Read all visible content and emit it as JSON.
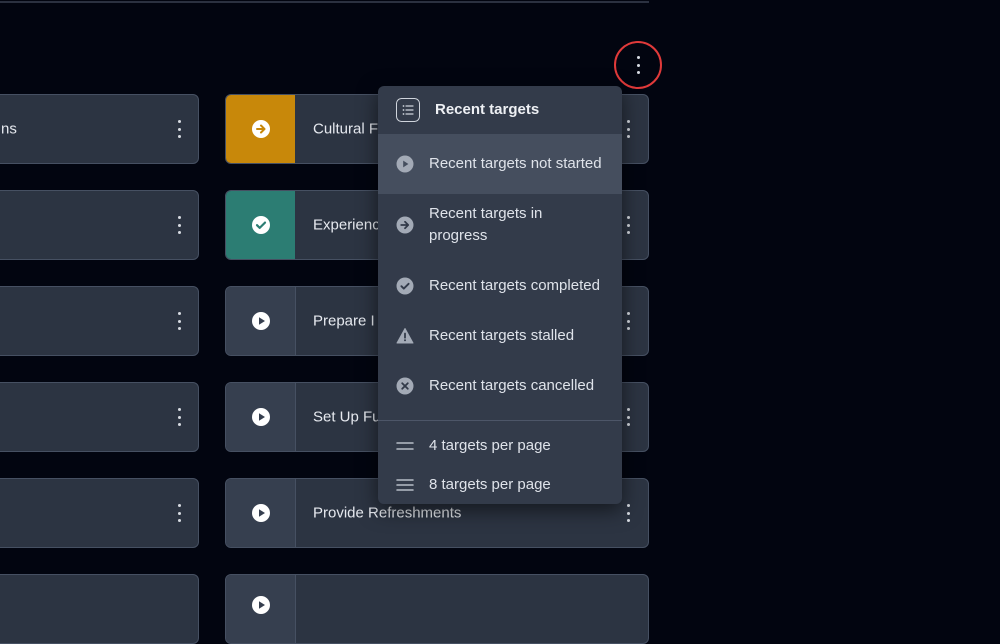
{
  "left_cards": [
    {
      "label": "ns"
    },
    {
      "label": ""
    },
    {
      "label": ""
    },
    {
      "label": ""
    },
    {
      "label": ""
    },
    {
      "label": ""
    }
  ],
  "right_cards": [
    {
      "label": "Cultural F",
      "status": "in-progress",
      "status_icon": "arrow-right-circle-icon",
      "status_color": "#c8880a"
    },
    {
      "label": "Experience",
      "status": "completed",
      "status_icon": "check-circle-icon",
      "status_color": "#2c7d73"
    },
    {
      "label": "Prepare I",
      "status": "not-started",
      "status_icon": "play-circle-icon",
      "status_color": "#363f4f"
    },
    {
      "label": "Set Up Fu",
      "status": "not-started",
      "status_icon": "play-circle-icon",
      "status_color": "#363f4f"
    },
    {
      "label": "Provide Refreshments",
      "status": "not-started",
      "status_icon": "play-circle-icon",
      "status_color": "#363f4f"
    },
    {
      "label": "",
      "status": "not-started",
      "status_icon": "play-circle-icon",
      "status_color": "#363f4f"
    }
  ],
  "menu": {
    "header": {
      "label": "Recent targets",
      "icon": "list-icon"
    },
    "items": [
      {
        "label": "Recent targets not started",
        "icon": "play-circle-icon",
        "active": true
      },
      {
        "label": "Recent targets in progress",
        "icon": "arrow-right-circle-icon",
        "active": false
      },
      {
        "label": "Recent targets completed",
        "icon": "check-circle-icon",
        "active": false
      },
      {
        "label": "Recent targets stalled",
        "icon": "warning-triangle-icon",
        "active": false
      },
      {
        "label": "Recent targets cancelled",
        "icon": "x-circle-icon",
        "active": false
      }
    ],
    "page_size_items": [
      {
        "label": "4 targets per page",
        "icon": "two-lines-icon"
      },
      {
        "label": "8 targets per page",
        "icon": "three-lines-icon"
      }
    ]
  },
  "colors": {
    "background": "#020510",
    "card": "#2c3442",
    "in_progress": "#c8880a",
    "completed": "#2c7d73",
    "highlight_ring": "#e03a3a"
  }
}
